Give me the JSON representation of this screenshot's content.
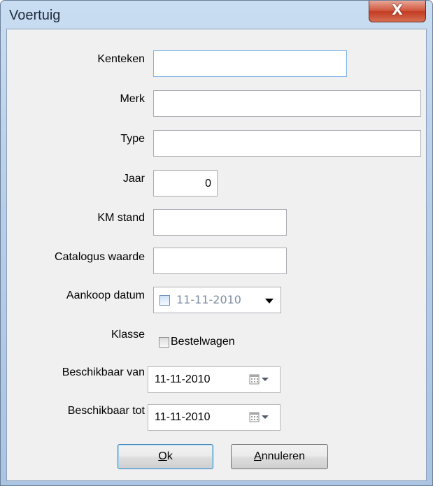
{
  "window": {
    "title": "Voertuig",
    "close_label": "X"
  },
  "fields": {
    "kenteken": {
      "label": "Kenteken",
      "value": ""
    },
    "merk": {
      "label": "Merk",
      "value": ""
    },
    "type": {
      "label": "Type",
      "value": ""
    },
    "jaar": {
      "label": "Jaar",
      "value": "0"
    },
    "km_stand": {
      "label": "KM stand",
      "value": ""
    },
    "catalogus_waarde": {
      "label": "Catalogus waarde",
      "value": ""
    },
    "aankoop_datum": {
      "label": "Aankoop datum",
      "value": "11-11-2010",
      "checked": false
    },
    "klasse": {
      "label": "Klasse",
      "checkbox_label": "Bestelwagen",
      "checked": false
    },
    "beschikbaar_van": {
      "label": "Beschikbaar van",
      "value": "11-11-2010"
    },
    "beschikbaar_tot": {
      "label": "Beschikbaar tot",
      "value": "11-11-2010"
    }
  },
  "buttons": {
    "ok_underline": "O",
    "ok_rest": "k",
    "cancel_underline": "A",
    "cancel_rest": "nnuleren"
  },
  "icons": {
    "calendar": "calendar-icon",
    "dropdown": "dropdown-arrow-icon",
    "close": "close-icon"
  }
}
